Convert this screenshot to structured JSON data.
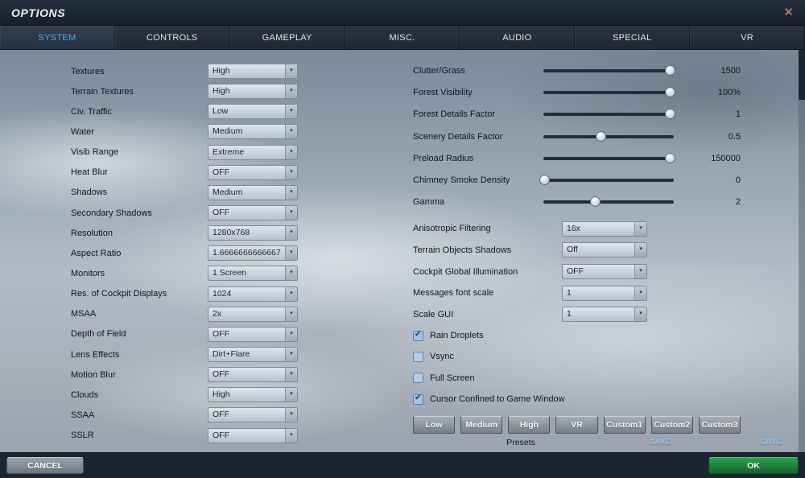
{
  "icons": {
    "close": "✕",
    "dropdown_arrow": "▾",
    "check": "✔"
  },
  "colors": {
    "accent_blue": "#4aa9f2",
    "ok_green": "#1f8a3e",
    "save_blue": "#8fc6f0",
    "close_orange": "#df8a5c"
  },
  "window": {
    "title": "OPTIONS"
  },
  "tabs": [
    {
      "label": "SYSTEM",
      "active": true
    },
    {
      "label": "CONTROLS",
      "active": false
    },
    {
      "label": "GAMEPLAY",
      "active": false
    },
    {
      "label": "MISC.",
      "active": false
    },
    {
      "label": "AUDIO",
      "active": false
    },
    {
      "label": "SPECIAL",
      "active": false
    },
    {
      "label": "VR",
      "active": false
    }
  ],
  "left_column": {
    "rows": [
      {
        "label": "Textures",
        "value": "High"
      },
      {
        "label": "Terrain Textures",
        "value": "High"
      },
      {
        "label": "Civ. Traffic",
        "value": "Low"
      },
      {
        "label": "Water",
        "value": "Medium"
      },
      {
        "label": "Visib Range",
        "value": "Extreme"
      },
      {
        "label": "Heat Blur",
        "value": "OFF"
      },
      {
        "label": "Shadows",
        "value": "Medium"
      },
      {
        "label": "Secondary Shadows",
        "value": "OFF"
      },
      {
        "label": "Resolution",
        "value": "1280x768"
      },
      {
        "label": "Aspect Ratio",
        "value": "1.6666666666667"
      },
      {
        "label": "Monitors",
        "value": "1 Screen"
      },
      {
        "label": "Res. of Cockpit Displays",
        "value": "1024"
      },
      {
        "label": "MSAA",
        "value": "2x"
      },
      {
        "label": "Depth of Field",
        "value": "OFF"
      },
      {
        "label": "Lens Effects",
        "value": "Dirt+Flare"
      },
      {
        "label": "Motion Blur",
        "value": "OFF"
      },
      {
        "label": "Clouds",
        "value": "High"
      },
      {
        "label": "SSAA",
        "value": "OFF"
      },
      {
        "label": "SSLR",
        "value": "OFF"
      }
    ]
  },
  "right_column": {
    "sliders": [
      {
        "label": "Clutter/Grass",
        "value": "1500",
        "percent": 97
      },
      {
        "label": "Forest Visibility",
        "value": "100%",
        "percent": 97
      },
      {
        "label": "Forest Details Factor",
        "value": "1",
        "percent": 97
      },
      {
        "label": "Scenery Details Factor",
        "value": "0.5",
        "percent": 44
      },
      {
        "label": "Preload Radius",
        "value": "150000",
        "percent": 97
      },
      {
        "label": "Chimney Smoke Density",
        "value": "0",
        "percent": 1
      },
      {
        "label": "Gamma",
        "value": "2",
        "percent": 40
      }
    ],
    "dropdowns": [
      {
        "label": "Anisotropic Filtering",
        "value": "16x"
      },
      {
        "label": "Terrain Objects Shadows",
        "value": "Off"
      },
      {
        "label": "Cockpit Global Illumination",
        "value": "OFF"
      },
      {
        "label": "Messages font scale",
        "value": "1"
      },
      {
        "label": "Scale GUI",
        "value": "1"
      }
    ],
    "checkboxes": [
      {
        "label": "Rain Droplets",
        "checked": true
      },
      {
        "label": "Vsync",
        "checked": false
      },
      {
        "label": "Full Screen",
        "checked": false
      },
      {
        "label": "Cursor Confined to Game Window",
        "checked": true
      }
    ],
    "presets": {
      "buttons": [
        {
          "label": "Low"
        },
        {
          "label": "Medium"
        },
        {
          "label": "High"
        },
        {
          "label": "VR"
        },
        {
          "label": "Custom1"
        },
        {
          "label": "Custom2"
        },
        {
          "label": "Custom3"
        }
      ],
      "caption": "Presets",
      "save_label": "SAVE"
    }
  },
  "footer": {
    "cancel_label": "CANCEL",
    "ok_label": "OK"
  }
}
